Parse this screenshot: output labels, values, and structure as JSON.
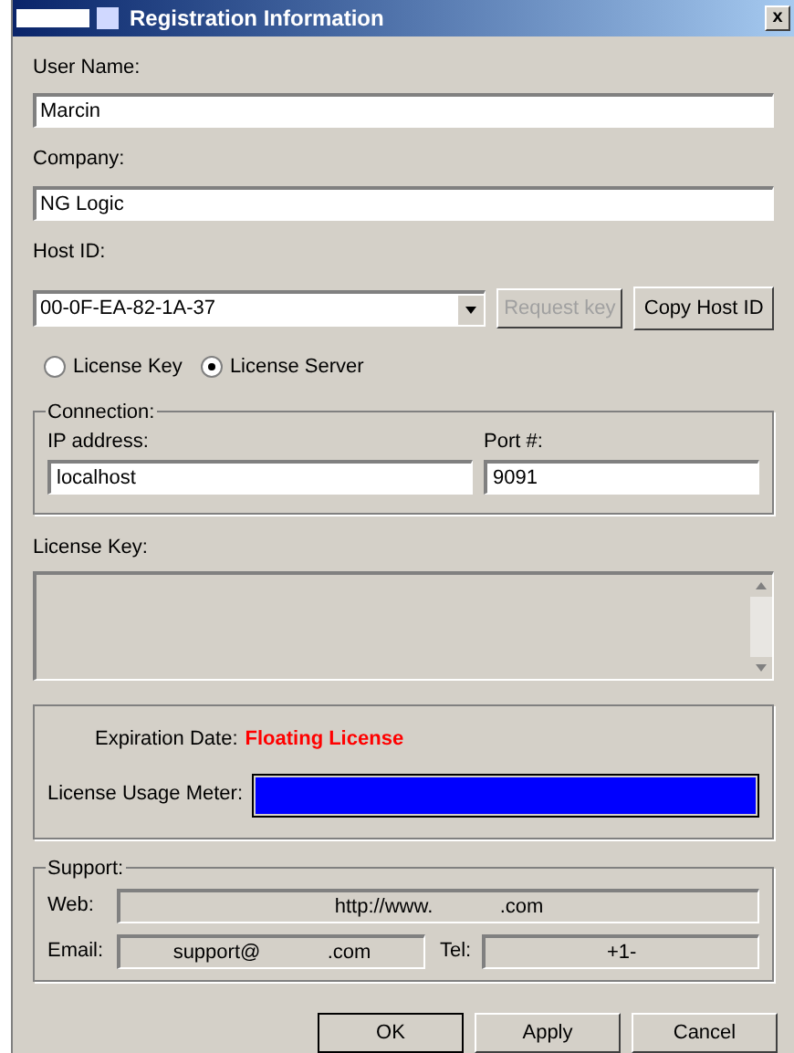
{
  "window": {
    "title": "Registration Information",
    "close": "x"
  },
  "user_name": {
    "label": "User Name:",
    "value": "Marcin"
  },
  "company": {
    "label": "Company:",
    "value": "NG Logic"
  },
  "host_id": {
    "label": "Host ID:",
    "value": "00-0F-EA-82-1A-37"
  },
  "host_buttons": [
    {
      "label": "Request key",
      "disabled": true
    },
    {
      "label": "Copy Host ID",
      "disabled": false
    }
  ],
  "license_type": [
    {
      "label": "License Key",
      "selected": false
    },
    {
      "label": "License Server",
      "selected": true
    }
  ],
  "connection": {
    "title": "Connection:",
    "ip_label": "IP address:",
    "ip_value": "localhost",
    "port_label": "Port #:",
    "port_value": "9091"
  },
  "license_key": {
    "label": "License Key:"
  },
  "status": {
    "expiration_label": "Expiration Date:",
    "expiration_value": "Floating License",
    "meter_label": "License Usage Meter:",
    "level": 1
  },
  "support": {
    "title": "Support:",
    "web_label": "Web:",
    "web_value": "http://www.            .com",
    "email_label": "Email:",
    "email_value": "support@            .com",
    "tel_label": "Tel:",
    "tel_value": "+1-"
  },
  "buttons": [
    {
      "label": "OK",
      "default": true
    },
    {
      "label": "Apply",
      "default": false
    },
    {
      "label": "Cancel",
      "default": false
    }
  ]
}
